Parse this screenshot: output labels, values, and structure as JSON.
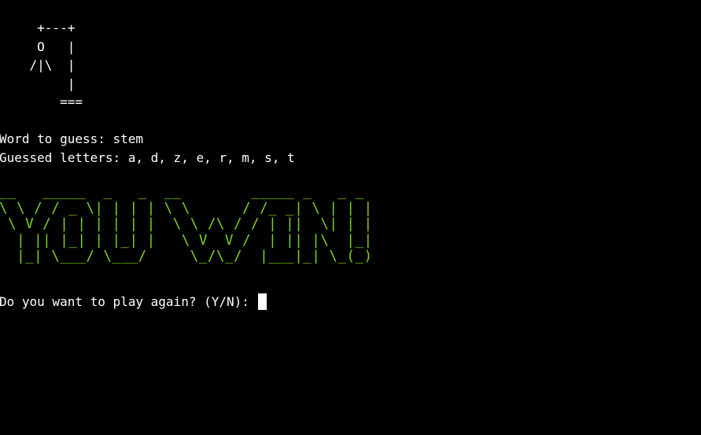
{
  "gallows_art": "     +---+\n     O   |\n    /|\\  |\n         |\n        ===",
  "word_line": "Word to guess: stem",
  "guessed_line": "Guessed letters: a, d, z, e, r, m, s, t",
  "win_banner": "__   _____  _   _  __        _____ _   _ _ \n\\ \\ / / _ \\| | | | \\ \\      / /_ _| \\ | | |\n \\ V / | | | | | |  \\ \\ /\\ / / | ||  \\| | |\n  | || |_| | |_| |   \\ V  V /  | || |\\  |_|\n  |_| \\___/ \\___/     \\_/\\_/  |___|_| \\_(_)",
  "prompt": "Do you want to play again? (Y/N):",
  "colors": {
    "background": "#000000",
    "text": "#ffffff",
    "banner": "#7dd420"
  }
}
